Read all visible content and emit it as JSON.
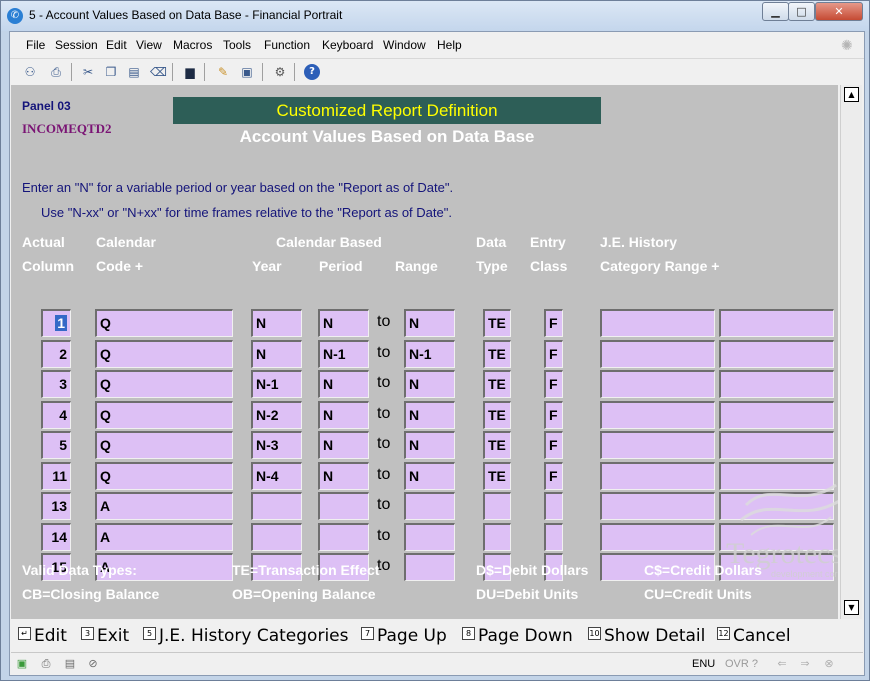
{
  "window": {
    "title": "5 - Account Values Based on Data Base - Financial Portrait",
    "min_glyph": "▁",
    "max_glyph": "□",
    "close_glyph": "✕"
  },
  "menu": [
    {
      "label": "File"
    },
    {
      "label": "Session"
    },
    {
      "label": "Edit"
    },
    {
      "label": "View"
    },
    {
      "label": "Macros"
    },
    {
      "label": "Tools"
    },
    {
      "label": "Function"
    },
    {
      "label": "Keyboard"
    },
    {
      "label": "Window"
    },
    {
      "label": "Help"
    }
  ],
  "toolbar_icons": [
    "connect-icon",
    "print-icon",
    "cut-icon",
    "copy-icon",
    "paste-icon",
    "eraser-icon",
    "screen-icon",
    "edit-note-icon",
    "display-icon",
    "gear-icon",
    "help-icon"
  ],
  "panel": {
    "id": "Panel 03",
    "report": "INCOMEQTD2",
    "banner": "Customized Report Definition",
    "subtitle": "Account Values Based on Data Base",
    "instr1": "Enter an \"N\" for a variable period or year based on the \"Report as of Date\".",
    "instr2": "Use \"N-xx\" or \"N+xx\" for time frames relative to the \"Report as of Date\"."
  },
  "headers": {
    "actual": "Actual",
    "column": "Column",
    "calendar": "Calendar",
    "code": "Code +",
    "cal_based": "Calendar Based",
    "year": "Year",
    "period": "Period",
    "range": "Range",
    "data": "Data",
    "type": "Type",
    "entry": "Entry",
    "class": "Class",
    "je_history": "J.E. History",
    "cat_range": "Category Range +"
  },
  "to_label": "to",
  "rows": [
    {
      "col": "1",
      "code": "Q",
      "year": "N",
      "period": "N",
      "range": "N",
      "dtype": "TE",
      "eclass": "F",
      "cat1": "",
      "cat2": ""
    },
    {
      "col": "2",
      "code": "Q",
      "year": "N",
      "period": "N-1",
      "range": "N-1",
      "dtype": "TE",
      "eclass": "F",
      "cat1": "",
      "cat2": ""
    },
    {
      "col": "3",
      "code": "Q",
      "year": "N-1",
      "period": "N",
      "range": "N",
      "dtype": "TE",
      "eclass": "F",
      "cat1": "",
      "cat2": ""
    },
    {
      "col": "4",
      "code": "Q",
      "year": "N-2",
      "period": "N",
      "range": "N",
      "dtype": "TE",
      "eclass": "F",
      "cat1": "",
      "cat2": ""
    },
    {
      "col": "5",
      "code": "Q",
      "year": "N-3",
      "period": "N",
      "range": "N",
      "dtype": "TE",
      "eclass": "F",
      "cat1": "",
      "cat2": ""
    },
    {
      "col": "11",
      "code": "Q",
      "year": "N-4",
      "period": "N",
      "range": "N",
      "dtype": "TE",
      "eclass": "F",
      "cat1": "",
      "cat2": ""
    },
    {
      "col": "13",
      "code": "A",
      "year": "",
      "period": "",
      "range": "",
      "dtype": "",
      "eclass": "",
      "cat1": "",
      "cat2": ""
    },
    {
      "col": "14",
      "code": "A",
      "year": "",
      "period": "",
      "range": "",
      "dtype": "",
      "eclass": "",
      "cat1": "",
      "cat2": ""
    },
    {
      "col": "15",
      "code": "A",
      "year": "",
      "period": "",
      "range": "",
      "dtype": "",
      "eclass": "",
      "cat1": "",
      "cat2": ""
    }
  ],
  "legend": {
    "valid": "Valid Data Types:",
    "te": "TE=Transaction Effect",
    "ds": "D$=Debit Dollars",
    "cs": "C$=Credit Dollars",
    "cb": "CB=Closing Balance",
    "ob": "OB=Opening Balance",
    "du": "DU=Debit Units",
    "cu": "CU=Credit Units"
  },
  "fkeys": [
    {
      "num": "↵",
      "label": "Edit"
    },
    {
      "num": "3",
      "label": "Exit"
    },
    {
      "num": "5",
      "label": "J.E. History Categories"
    },
    {
      "num": "7",
      "label": "Page Up"
    },
    {
      "num": "8",
      "label": "Page Down"
    },
    {
      "num": "10",
      "label": "Show Detail"
    },
    {
      "num": "12",
      "label": "Cancel"
    }
  ],
  "status": {
    "lang": "ENU",
    "ovr": "OVR ?"
  },
  "watermark": {
    "brand": "Tegrotecs",
    "tagline": "development corp."
  }
}
